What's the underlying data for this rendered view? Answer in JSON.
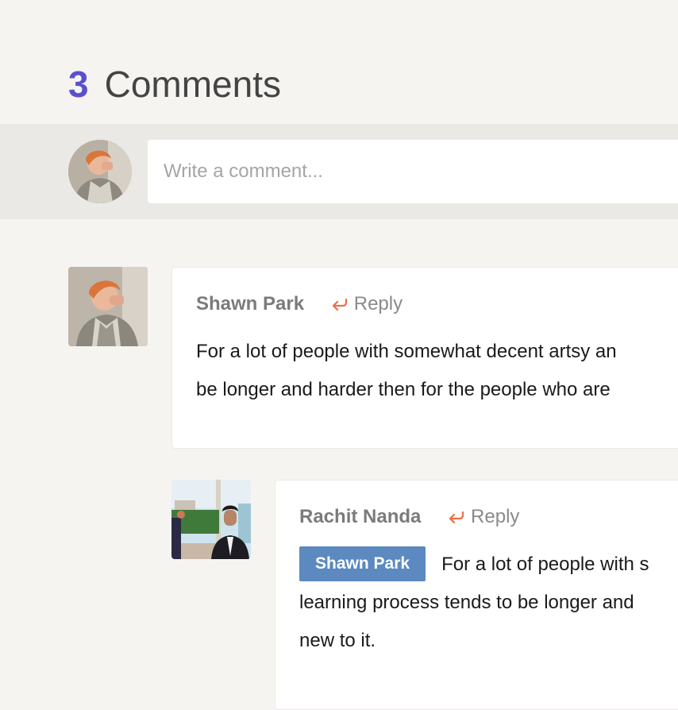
{
  "header": {
    "count": "3",
    "label": "Comments"
  },
  "composer": {
    "placeholder": "Write a comment..."
  },
  "comments": [
    {
      "author": "Shawn Park",
      "reply_label": "Reply",
      "lines": [
        "For a lot of people with somewhat decent artsy an",
        "be longer and harder then for the people who are"
      ]
    },
    {
      "author": "Rachit Nanda",
      "reply_label": "Reply",
      "mention": "Shawn Park",
      "lines": [
        "For a lot of people with s",
        "learning process tends to be longer and",
        "new to it."
      ]
    }
  ],
  "colors": {
    "accent": "#5a4fcf",
    "reply_icon": "#ee6f43",
    "mention_bg": "#5b89c0",
    "band": "#ebe9e5",
    "page": "#f5f4f1"
  },
  "icons": {
    "reply": "reply-arrow-icon"
  }
}
